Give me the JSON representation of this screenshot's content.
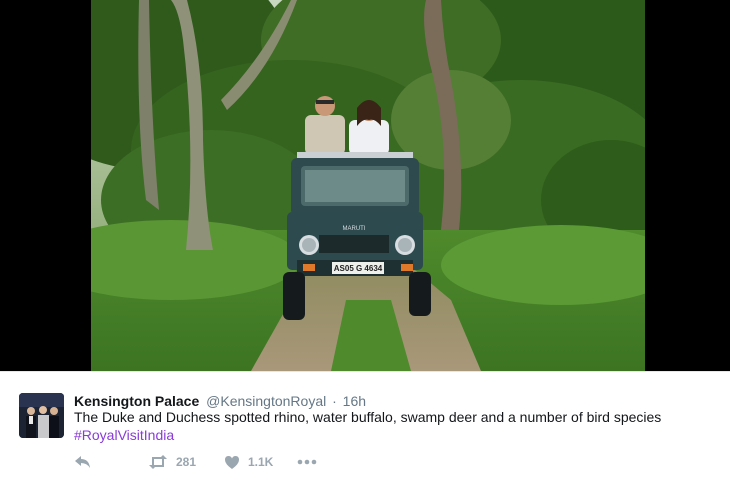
{
  "photo": {
    "alt_icon": "safari-photo",
    "plate": "AS05 G 4634",
    "brand": "MARUTI"
  },
  "tweet": {
    "avatar_icon": "avatar-photo",
    "author_name": "Kensington Palace",
    "handle": "@KensingtonRoyal",
    "separator": "·",
    "time": "16h",
    "text": "The Duke and Duchess spotted rhino, water buffalo, swamp deer and a number of bird species",
    "hashtag": "#RoyalVisitIndia",
    "hashtag_color": "#8a3bd7"
  },
  "actions": {
    "reply_icon": "reply-icon",
    "retweet_icon": "retweet-icon",
    "retweet_count": "281",
    "like_icon": "heart-icon",
    "like_count": "1.1K",
    "more_icon": "more-icon"
  }
}
